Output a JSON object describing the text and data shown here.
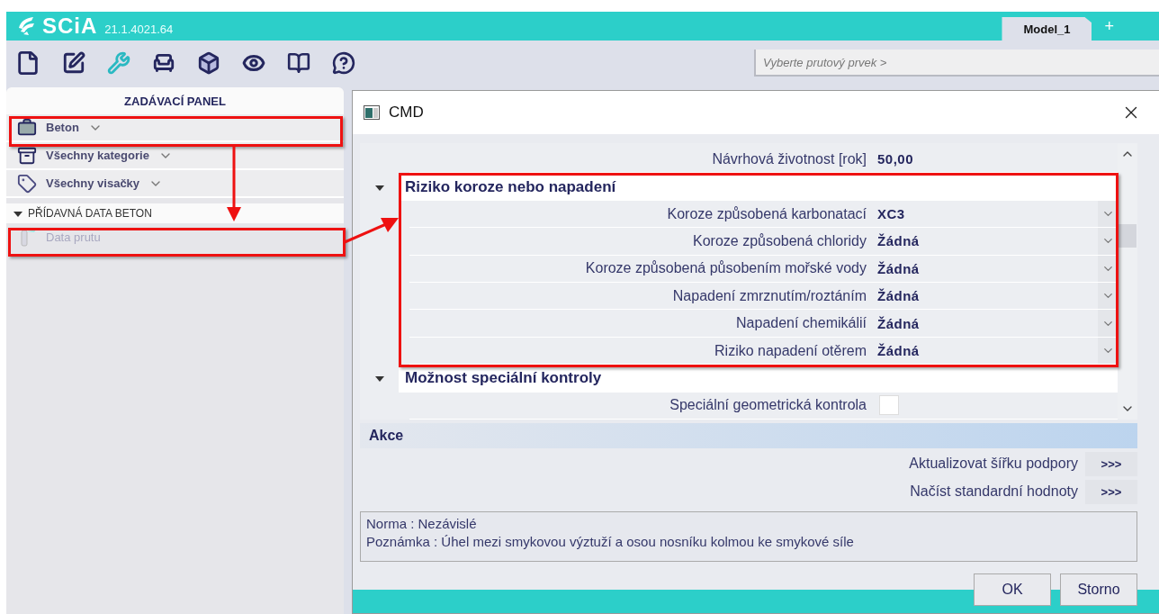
{
  "header": {
    "logo": "SCiA",
    "version": "21.1.4021.64",
    "tabs": [
      {
        "label": "Model_1",
        "selected": true
      }
    ],
    "add_tab": "+"
  },
  "selector": {
    "placeholder": "Vyberte prutový prvek >"
  },
  "panel": {
    "title": "ZADÁVACÍ PANEL",
    "dropdowns": [
      {
        "kind": "briefcase",
        "label": "Beton"
      },
      {
        "kind": "cabinet",
        "label": "Všechny kategorie"
      },
      {
        "kind": "tag",
        "label": "Všechny visačky"
      }
    ],
    "section": {
      "title": "PŘÍDAVNÁ DATA BETON",
      "expanded": true,
      "items": [
        {
          "label": "Data prutu",
          "disabled": true
        }
      ]
    }
  },
  "dialog": {
    "title": "CMD",
    "properties": [
      {
        "kind": "value",
        "label": "Návrhová životnost [rok]",
        "value": "50,00"
      },
      {
        "kind": "group",
        "title": "Riziko koroze nebo napadení",
        "expanded": true,
        "rows": [
          {
            "kind": "select",
            "label": "Koroze způsobená karbonatací",
            "value": "XC3"
          },
          {
            "kind": "select",
            "label": "Koroze způsobená chloridy",
            "value": "Žádná"
          },
          {
            "kind": "select",
            "label": "Koroze způsobená působením mořské vody",
            "value": "Žádná"
          },
          {
            "kind": "select",
            "label": "Napadení zmrznutím/roztáním",
            "value": "Žádná"
          },
          {
            "kind": "select",
            "label": "Napadení chemikálií",
            "value": "Žádná"
          },
          {
            "kind": "select",
            "label": "Riziko napadení otěrem",
            "value": "Žádná"
          }
        ]
      },
      {
        "kind": "group",
        "title": "Možnost speciální kontroly",
        "expanded": true,
        "rows": [
          {
            "kind": "checkbox",
            "label": "Speciální geometrická kontrola",
            "checked": false
          }
        ]
      }
    ],
    "actions_title": "Akce",
    "actions": [
      {
        "label": "Aktualizovat šířku podpory",
        "button": ">>>"
      },
      {
        "label": "Načíst standardní hodnoty",
        "button": ">>>"
      }
    ],
    "info": [
      "Norma : Nezávislé",
      "Poznámka : Úhel mezi smykovou výztuží a osou nosníku kolmou ke smykové síle"
    ],
    "buttons": [
      "OK",
      "Storno"
    ]
  }
}
